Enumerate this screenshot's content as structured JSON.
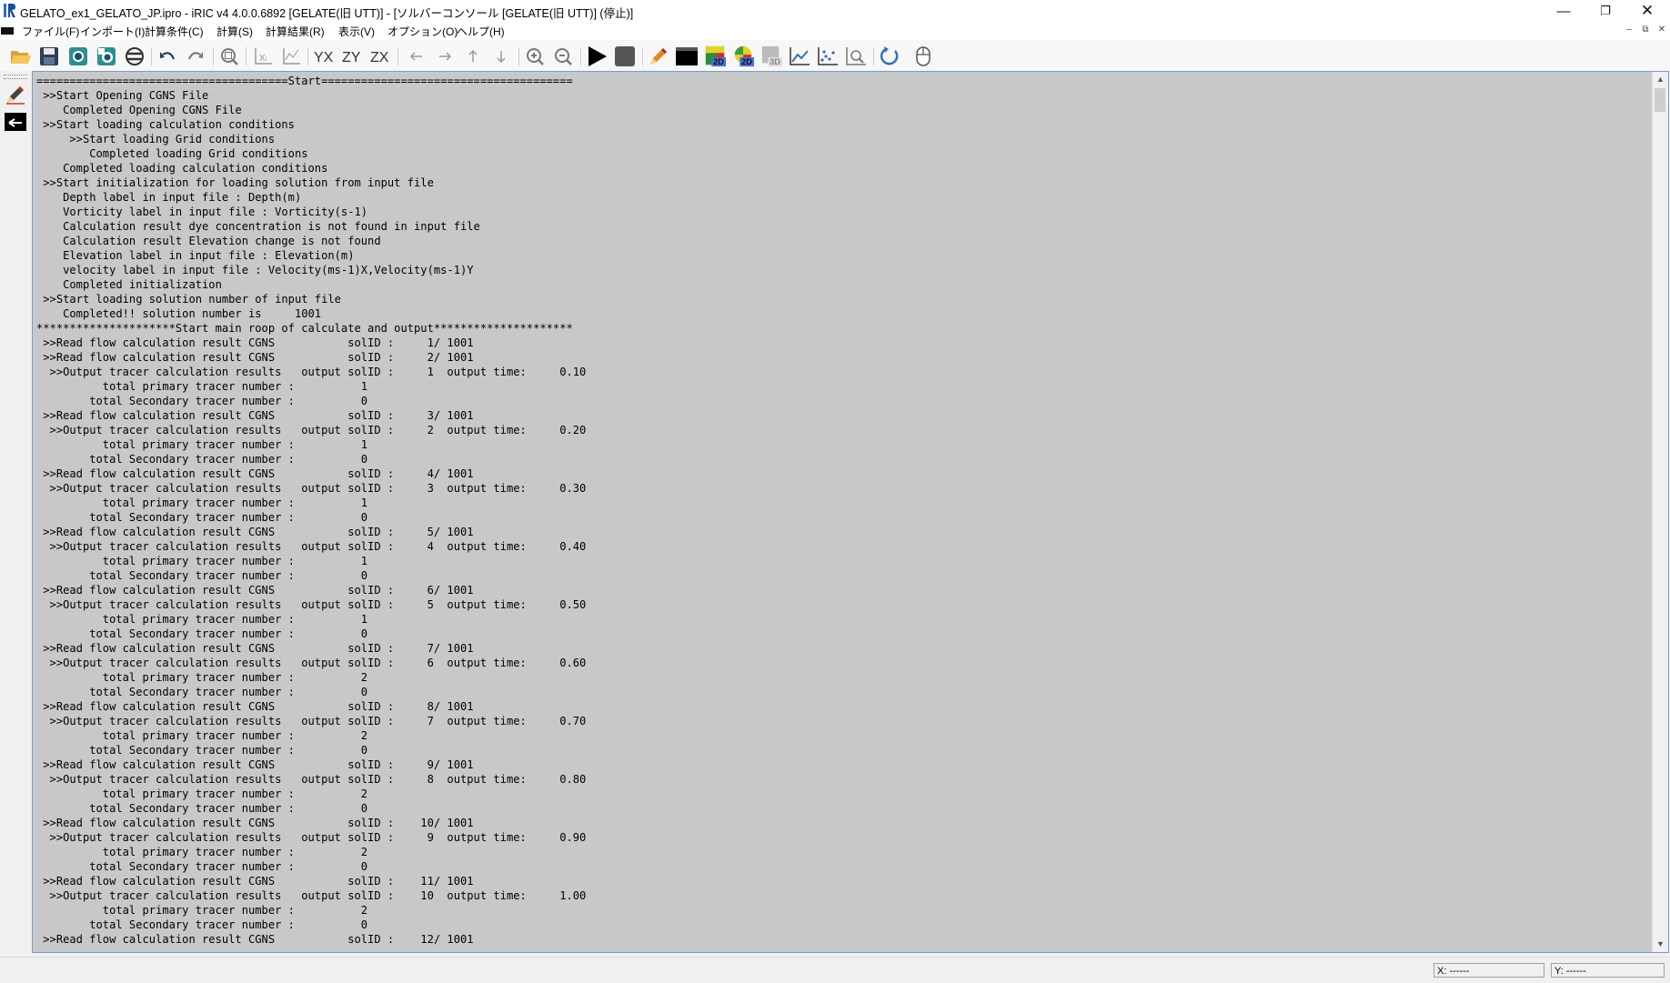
{
  "window": {
    "title": "GELATO_ex1_GELATO_JP.ipro - iRIC v4 4.0.0.6892 [GELATE(旧 UTT)] - [ソルバーコンソール [GELATE(旧 UTT)] (停止)]",
    "controls": {
      "minimize": "—",
      "restore": "❐",
      "close": "✕"
    }
  },
  "menubar": {
    "items": [
      "ファイル(F)",
      "インポート(I)",
      "計算条件(C)",
      "計算(S)",
      "計算結果(R)",
      "表示(V)",
      "オプション(O)",
      "ヘルプ(H)"
    ],
    "mdi_controls": {
      "minimize": "–",
      "restore": "⧉",
      "close": "✕"
    }
  },
  "toolbar": {
    "buttons": [
      "open-icon",
      "save-icon",
      "snapshot-icon",
      "continuous-snapshot-icon",
      "animation-icon",
      "undo-icon",
      "redo-icon",
      "zoom-fit-icon",
      "x-axis-fit-icon",
      "y-axis-fit-icon",
      "yx-view-icon",
      "zy-view-icon",
      "zx-view-icon",
      "arrow-left-icon",
      "arrow-right-icon",
      "arrow-up-icon",
      "arrow-down-icon",
      "zoom-in-icon",
      "zoom-out-icon",
      "run-icon",
      "stop-icon",
      "pre-processor-icon",
      "solver-console-icon",
      "post-2d-icon",
      "post-2d-bird-icon",
      "post-3d-icon",
      "graph-icon",
      "scatter-icon",
      "particle-icon",
      "reload-icon",
      "mouse-help-icon"
    ],
    "labels": {
      "xl": "Xₗ",
      "xr": "Xᵣ",
      "yx": "YX",
      "zy": "ZY",
      "zx": "ZX",
      "p2d": "2D",
      "p3d": "3D"
    },
    "colors": {
      "run": "#000000",
      "stop": "#555555",
      "accent_blue": "#3a6fb0"
    }
  },
  "console": {
    "background": "#c8c8c8",
    "lines": [
      "======================================Start======================================",
      " >>Start Opening CGNS File",
      "    Completed Opening CGNS File",
      " >>Start loading calculation conditions",
      "     >>Start loading Grid conditions",
      "        Completed loading Grid conditions",
      "    Completed loading calculation conditions",
      " >>Start initialization for loading solution from input file",
      "    Depth label in input file : Depth(m)",
      "    Vorticity label in input file : Vorticity(s-1)",
      "    Calculation result dye concentration is not found in input file",
      "    Calculation result Elevation change is not found",
      "    Elevation label in input file : Elevation(m)",
      "    velocity label in input file : Velocity(ms-1)X,Velocity(ms-1)Y",
      "    Completed initialization",
      " >>Start loading solution number of input file",
      "    Completed!! solution number is     1001",
      "*********************Start main roop of calculate and output*********************",
      " >>Read flow calculation result CGNS           solID :     1/ 1001",
      " >>Read flow calculation result CGNS           solID :     2/ 1001",
      "  >>Output tracer calculation results   output solID :     1  output time:     0.10",
      "          total primary tracer number :          1",
      "        total Secondary tracer number :          0",
      " >>Read flow calculation result CGNS           solID :     3/ 1001",
      "  >>Output tracer calculation results   output solID :     2  output time:     0.20",
      "          total primary tracer number :          1",
      "        total Secondary tracer number :          0",
      " >>Read flow calculation result CGNS           solID :     4/ 1001",
      "  >>Output tracer calculation results   output solID :     3  output time:     0.30",
      "          total primary tracer number :          1",
      "        total Secondary tracer number :          0",
      " >>Read flow calculation result CGNS           solID :     5/ 1001",
      "  >>Output tracer calculation results   output solID :     4  output time:     0.40",
      "          total primary tracer number :          1",
      "        total Secondary tracer number :          0",
      " >>Read flow calculation result CGNS           solID :     6/ 1001",
      "  >>Output tracer calculation results   output solID :     5  output time:     0.50",
      "          total primary tracer number :          1",
      "        total Secondary tracer number :          0",
      " >>Read flow calculation result CGNS           solID :     7/ 1001",
      "  >>Output tracer calculation results   output solID :     6  output time:     0.60",
      "          total primary tracer number :          2",
      "        total Secondary tracer number :          0",
      " >>Read flow calculation result CGNS           solID :     8/ 1001",
      "  >>Output tracer calculation results   output solID :     7  output time:     0.70",
      "          total primary tracer number :          2",
      "        total Secondary tracer number :          0",
      " >>Read flow calculation result CGNS           solID :     9/ 1001",
      "  >>Output tracer calculation results   output solID :     8  output time:     0.80",
      "          total primary tracer number :          2",
      "        total Secondary tracer number :          0",
      " >>Read flow calculation result CGNS           solID :    10/ 1001",
      "  >>Output tracer calculation results   output solID :     9  output time:     0.90",
      "          total primary tracer number :          2",
      "        total Secondary tracer number :          0",
      " >>Read flow calculation result CGNS           solID :    11/ 1001",
      "  >>Output tracer calculation results   output solID :    10  output time:     1.00",
      "          total primary tracer number :          2",
      "        total Secondary tracer number :          0",
      " >>Read flow calculation result CGNS           solID :    12/ 1001"
    ]
  },
  "statusbar": {
    "x": "X: ------",
    "y": "Y: ------"
  }
}
